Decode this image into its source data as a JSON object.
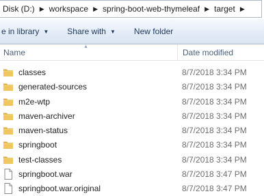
{
  "breadcrumb": {
    "items": [
      "Disk (D:)",
      "workspace",
      "spring-boot-web-thymeleaf",
      "target"
    ]
  },
  "toolbar": {
    "include_label": "e in library",
    "share_label": "Share with",
    "newfolder_label": "New folder"
  },
  "columns": {
    "name": "Name",
    "date": "Date modified"
  },
  "files": [
    {
      "name": "classes",
      "date": "8/7/2018 3:34 PM",
      "icon": "folder-icon"
    },
    {
      "name": "generated-sources",
      "date": "8/7/2018 3:34 PM",
      "icon": "folder-icon"
    },
    {
      "name": "m2e-wtp",
      "date": "8/7/2018 3:34 PM",
      "icon": "folder-icon"
    },
    {
      "name": "maven-archiver",
      "date": "8/7/2018 3:34 PM",
      "icon": "folder-icon"
    },
    {
      "name": "maven-status",
      "date": "8/7/2018 3:34 PM",
      "icon": "folder-icon"
    },
    {
      "name": "springboot",
      "date": "8/7/2018 3:34 PM",
      "icon": "folder-icon"
    },
    {
      "name": "test-classes",
      "date": "8/7/2018 3:34 PM",
      "icon": "folder-icon"
    },
    {
      "name": "springboot.war",
      "date": "8/7/2018 3:47 PM",
      "icon": "file-icon"
    },
    {
      "name": "springboot.war.original",
      "date": "8/7/2018 3:47 PM",
      "icon": "file-icon"
    }
  ],
  "colors": {
    "folder": "#f0c75e",
    "folder_dark": "#dba83a",
    "command_text": "#1e395b",
    "header_text": "#4c607a",
    "date_text": "#6d6d6d"
  }
}
